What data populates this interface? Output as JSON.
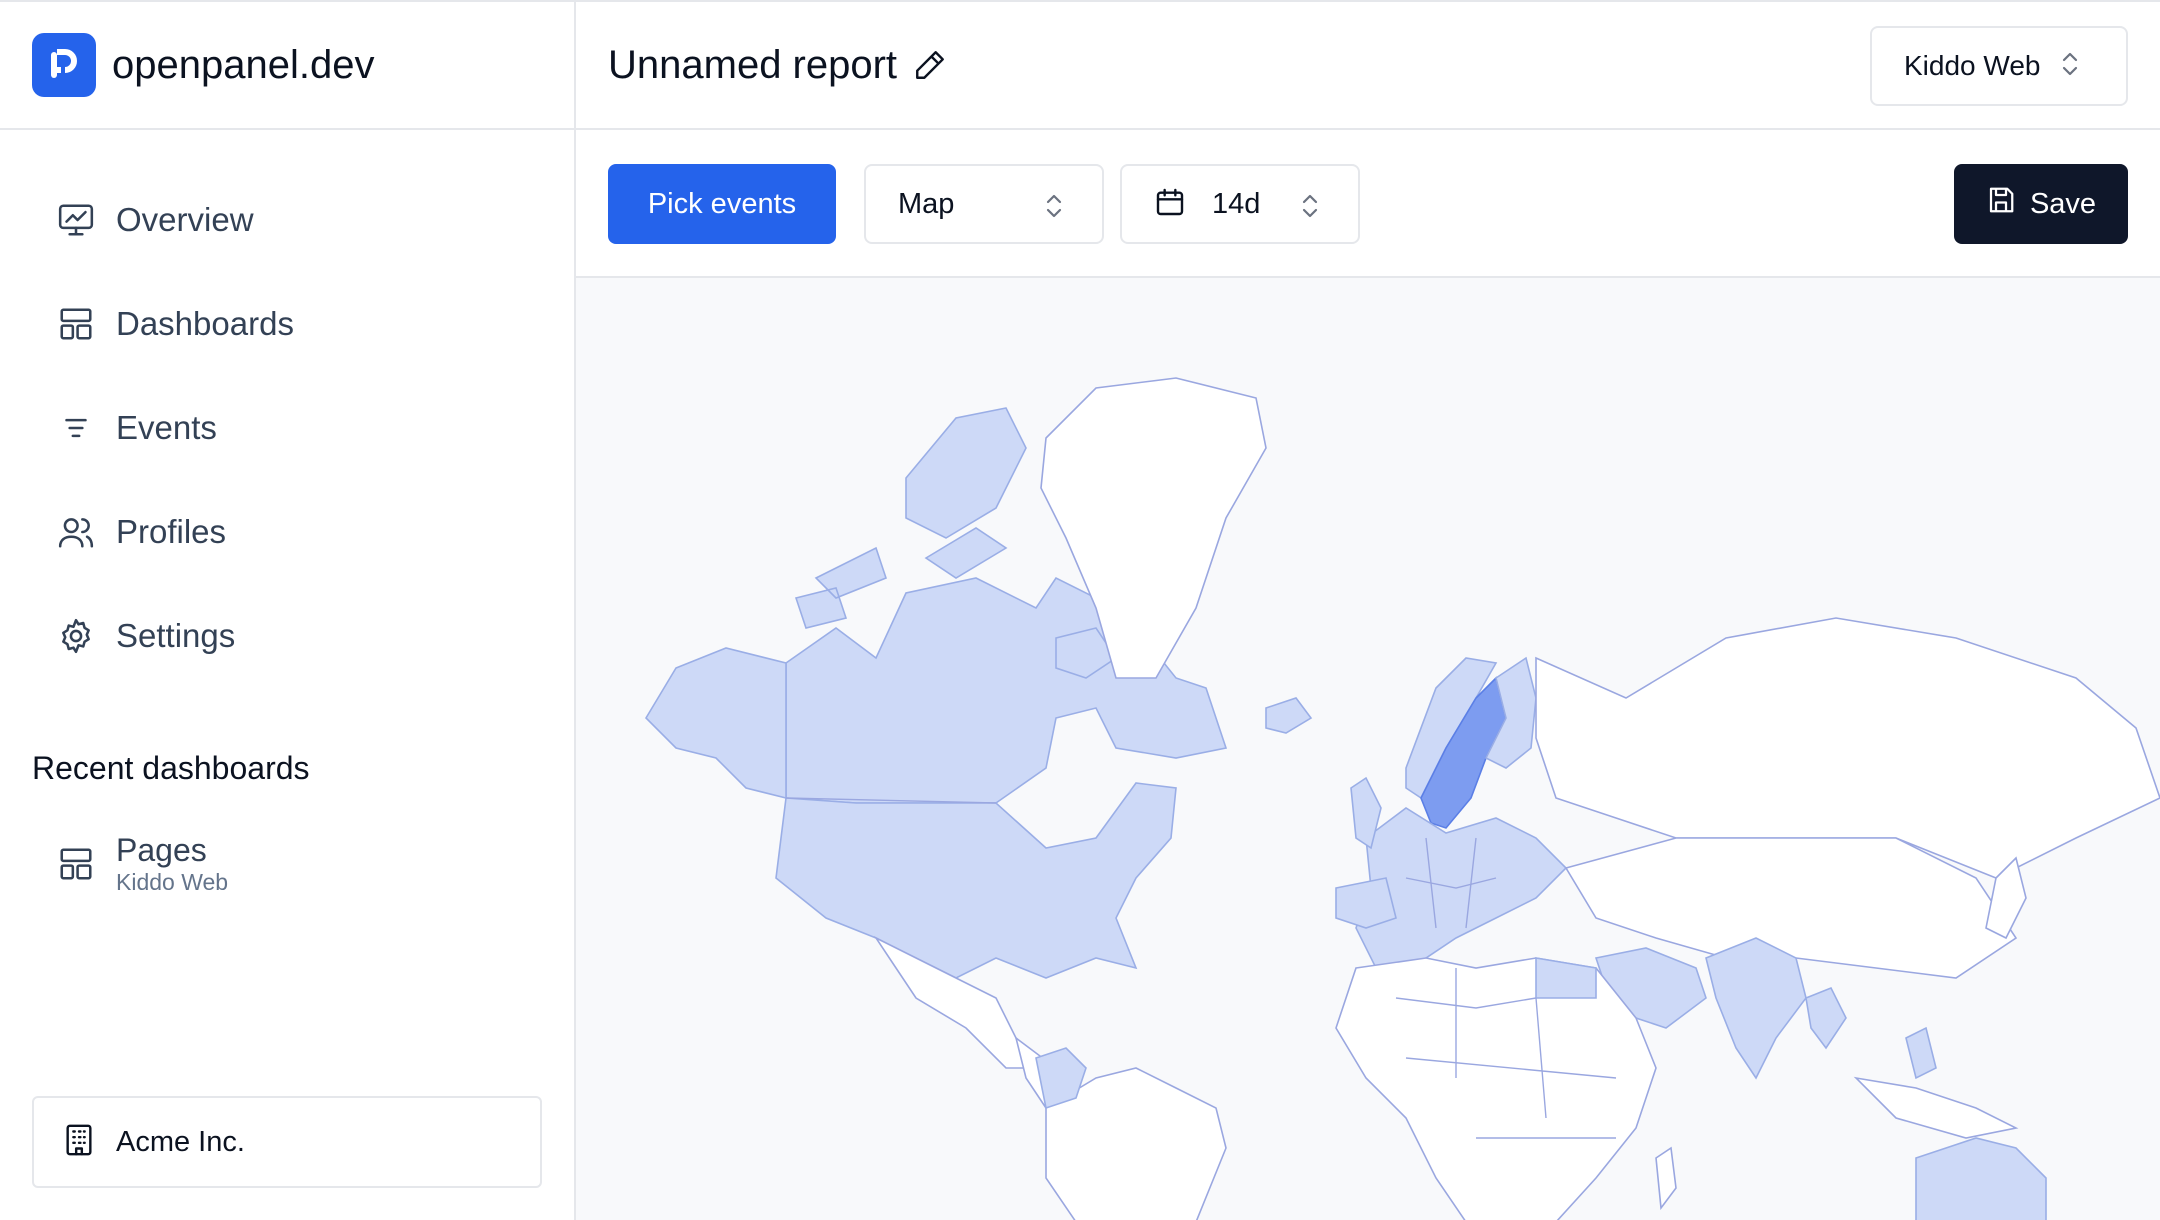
{
  "brand": {
    "name": "openpanel.dev",
    "logo_color": "#2563eb"
  },
  "sidebar": {
    "items": [
      {
        "label": "Overview",
        "icon": "monitor-chart-icon"
      },
      {
        "label": "Dashboards",
        "icon": "layout-grid-icon"
      },
      {
        "label": "Events",
        "icon": "list-filter-icon"
      },
      {
        "label": "Profiles",
        "icon": "users-icon"
      },
      {
        "label": "Settings",
        "icon": "gear-icon"
      }
    ],
    "recent_title": "Recent dashboards",
    "recent": [
      {
        "title": "Pages",
        "subtitle": "Kiddo Web",
        "icon": "layout-grid-icon"
      }
    ],
    "organization": {
      "label": "Acme Inc.",
      "icon": "building-icon"
    }
  },
  "header": {
    "title": "Unnamed report",
    "edit_icon": "pencil-icon",
    "project": "Kiddo Web"
  },
  "toolbar": {
    "pick_events": "Pick events",
    "chart_type": "Map",
    "range": "14d",
    "range_icon": "calendar-icon",
    "save": "Save",
    "save_icon": "save-icon"
  },
  "colors": {
    "primary": "#2563eb",
    "dark": "#0f172a",
    "map_low": "#cdd9f7",
    "map_high": "#7d9cf0"
  }
}
